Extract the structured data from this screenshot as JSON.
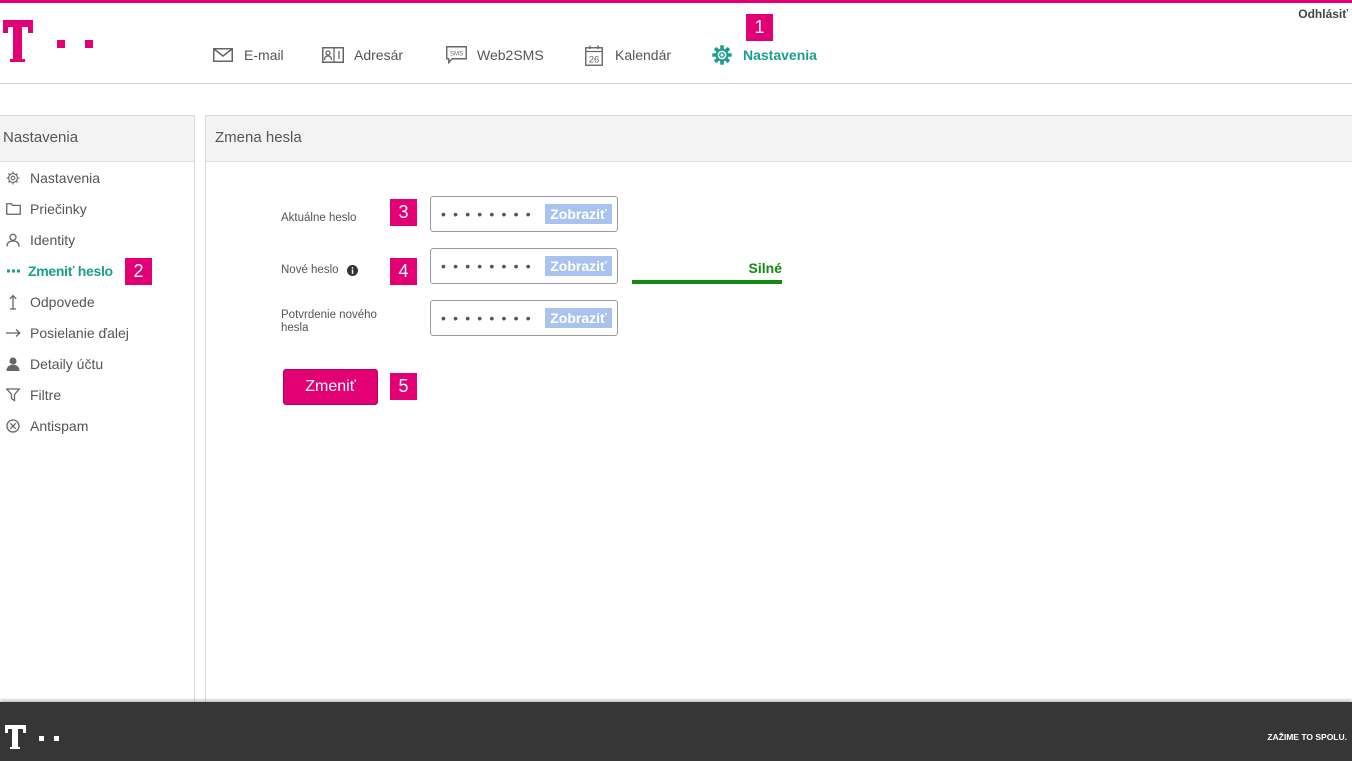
{
  "colors": {
    "brand": "#e20074",
    "accent": "#1a9e8d",
    "text": "#555555",
    "strength": "#128a12",
    "reveal_bg": "#a9c3ee",
    "footer_bg": "#363636"
  },
  "header": {
    "logo_icon": "telekom-logo",
    "logout": "Odhlásiť",
    "nav": [
      {
        "label": "E-mail",
        "icon": "envelope-icon"
      },
      {
        "label": "Adresár",
        "icon": "address-book-icon"
      },
      {
        "label": "Web2SMS",
        "icon": "sms-icon",
        "icon_text": "SMS"
      },
      {
        "label": "Kalendár",
        "icon": "calendar-icon",
        "icon_text": "26"
      },
      {
        "label": "Nastavenia",
        "icon": "gear-icon",
        "active": true
      }
    ]
  },
  "annotations": [
    "1",
    "2",
    "3",
    "4",
    "5"
  ],
  "sidebar": {
    "title": "Nastavenia",
    "items": [
      {
        "label": "Nastavenia",
        "icon": "gear-icon"
      },
      {
        "label": "Priečinky",
        "icon": "folder-icon"
      },
      {
        "label": "Identity",
        "icon": "person-outline-icon"
      },
      {
        "label": "Zmeniť heslo",
        "icon": "dots-icon",
        "active": true
      },
      {
        "label": "Odpovede",
        "icon": "arrow-up-icon"
      },
      {
        "label": "Posielanie ďalej",
        "icon": "arrow-right-icon"
      },
      {
        "label": "Detaily účtu",
        "icon": "person-icon"
      },
      {
        "label": "Filtre",
        "icon": "funnel-icon"
      },
      {
        "label": "Antispam",
        "icon": "circle-x-icon"
      }
    ]
  },
  "main": {
    "title": "Zmena hesla",
    "fields": [
      {
        "label": "Aktuálne heslo",
        "value": "••••••••",
        "reveal_label": "Zobraziť"
      },
      {
        "label": "Nové heslo",
        "value": "••••••••",
        "reveal_label": "Zobraziť",
        "info_icon": "info-icon"
      },
      {
        "label": "Potvrdenie nového hesla",
        "value": "••••••••",
        "reveal_label": "Zobraziť"
      }
    ],
    "strength": {
      "label": "Silné",
      "level": 1.0
    },
    "submit_label": "Zmeniť"
  },
  "footer": {
    "logo_icon": "telekom-logo",
    "slogan": "ZAŽIME TO SPOLU."
  }
}
